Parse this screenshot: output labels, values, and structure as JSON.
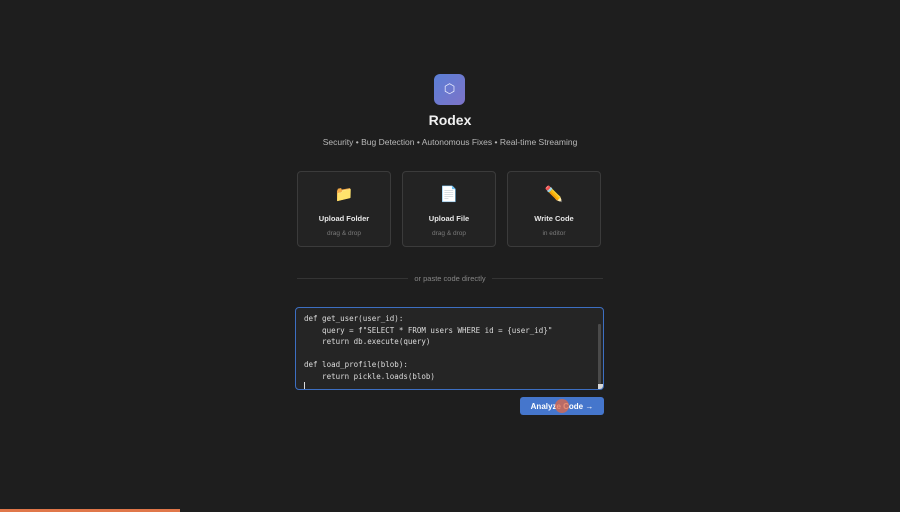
{
  "app": {
    "logo_glyph": "⬡",
    "title": "Rodex",
    "tagline": "Security • Bug Detection • Autonomous Fixes • Real-time Streaming"
  },
  "cards": [
    {
      "icon": "folder-icon",
      "glyph": "📁",
      "title": "Upload Folder",
      "subtitle": "drag & drop"
    },
    {
      "icon": "file-icon",
      "glyph": "📄",
      "title": "Upload File",
      "subtitle": "drag & drop"
    },
    {
      "icon": "pencil-icon",
      "glyph": "✏️",
      "title": "Write Code",
      "subtitle": "in editor"
    }
  ],
  "divider": {
    "text": "or paste code directly"
  },
  "editor": {
    "code": "def get_user(user_id):\n    query = f\"SELECT * FROM users WHERE id = {user_id}\"\n    return db.execute(query)\n\ndef load_profile(blob):\n    return pickle.loads(blob)"
  },
  "analyze_button": {
    "label": "Analyze Code →"
  },
  "progress": {
    "fraction": 0.2
  },
  "colors": {
    "background": "#1e1e1e",
    "accent": "#4576cc",
    "editor_border": "#3d6fc2",
    "progress": "#e0774a"
  }
}
